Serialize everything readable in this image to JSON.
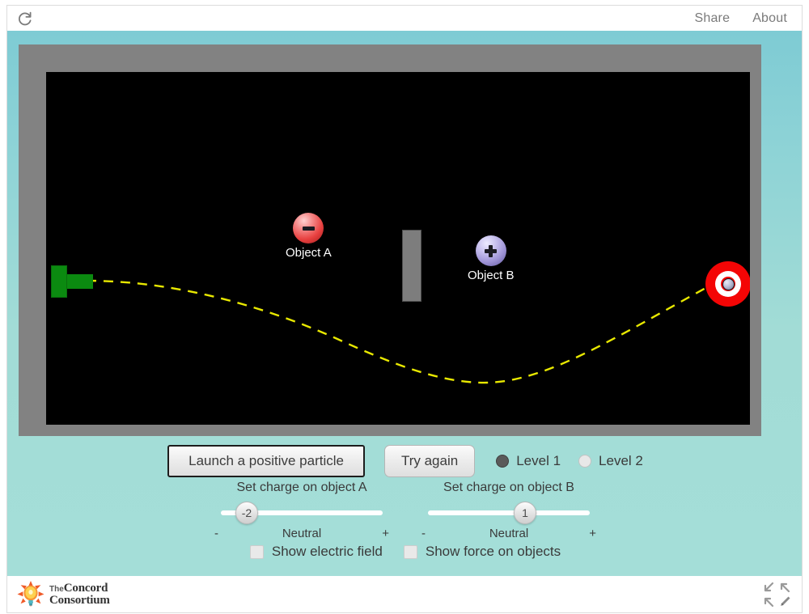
{
  "topbar": {
    "reload_icon": "reload-icon",
    "links": [
      {
        "label": "Share"
      },
      {
        "label": "About"
      }
    ]
  },
  "simulation": {
    "launcher": {
      "name": "particle-launcher",
      "color": "#0b8a10"
    },
    "obstacle": {
      "name": "wall-obstacle",
      "color": "#7d7d7d"
    },
    "target": {
      "name": "bullseye-target",
      "color": "#f40505"
    },
    "trajectory": {
      "name": "particle-trajectory",
      "color": "#e8e800",
      "style": "dashed"
    },
    "objects": [
      {
        "id": "A",
        "label": "Object A",
        "sign": "minus",
        "color": "#e8403f"
      },
      {
        "id": "B",
        "label": "Object B",
        "sign": "plus",
        "color": "#9e93d6"
      }
    ]
  },
  "controls": {
    "launch_label": "Launch a positive particle",
    "try_again_label": "Try again",
    "levels": [
      {
        "label": "Level 1",
        "selected": true
      },
      {
        "label": "Level 2",
        "selected": false
      }
    ],
    "sliders": [
      {
        "title": "Set charge on object A",
        "value": "-2",
        "min_label": "-",
        "mid_label": "Neutral",
        "max_label": "+",
        "handle_pct": 20
      },
      {
        "title": "Set charge on object B",
        "value": "1",
        "min_label": "-",
        "mid_label": "Neutral",
        "max_label": "+",
        "handle_pct": 60
      }
    ],
    "checkboxes": [
      {
        "label": "Show electric field",
        "checked": false
      },
      {
        "label": "Show force on objects",
        "checked": false
      }
    ]
  },
  "footer": {
    "logo": {
      "the": "The",
      "line1": "Concord",
      "line2": "Consortium"
    },
    "icons": [
      "arrow-top-left-icon",
      "arrow-top-right-icon",
      "arrow-bottom-left-icon",
      "pencil-icon"
    ]
  },
  "colors": {
    "panel_teal_top": "#7ecbd4",
    "panel_teal_bottom": "#a4ded8",
    "canvas": "#000000",
    "frame_gray": "#828282"
  }
}
